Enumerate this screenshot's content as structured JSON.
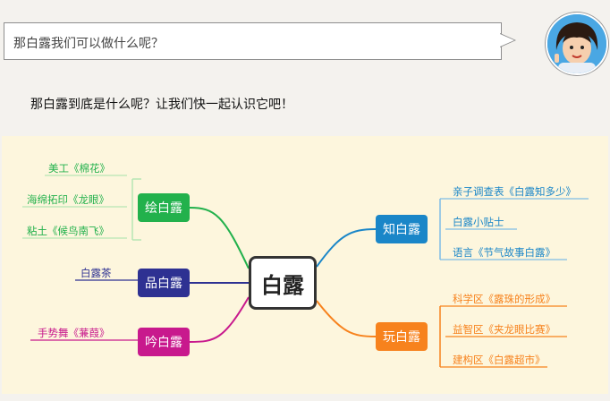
{
  "chat": {
    "question": "那白露我们可以做什么呢？",
    "intro": "那白露到底是什么呢？让我们快一起认识它吧！"
  },
  "mindmap": {
    "center": "白露",
    "branches": [
      {
        "label": "绘白露",
        "color": "#22b14c",
        "items": [
          "美工《棉花》",
          "海绵拓印《龙眼》",
          "粘土《候鸟南飞》"
        ]
      },
      {
        "label": "品白露",
        "color": "#2e3192",
        "items": [
          "白露茶"
        ]
      },
      {
        "label": "吟白露",
        "color": "#c8198d",
        "items": [
          "手势舞《蒹葭》"
        ]
      },
      {
        "label": "知白露",
        "color": "#1a86c8",
        "items": [
          "亲子调查表《白露知多少》",
          "白露小贴士",
          "语言《节气故事白露》"
        ]
      },
      {
        "label": "玩白露",
        "color": "#f7821d",
        "items": [
          "科学区《露珠的形成》",
          "益智区《夹龙眼比赛》",
          "建构区《白露超市》"
        ]
      }
    ]
  }
}
